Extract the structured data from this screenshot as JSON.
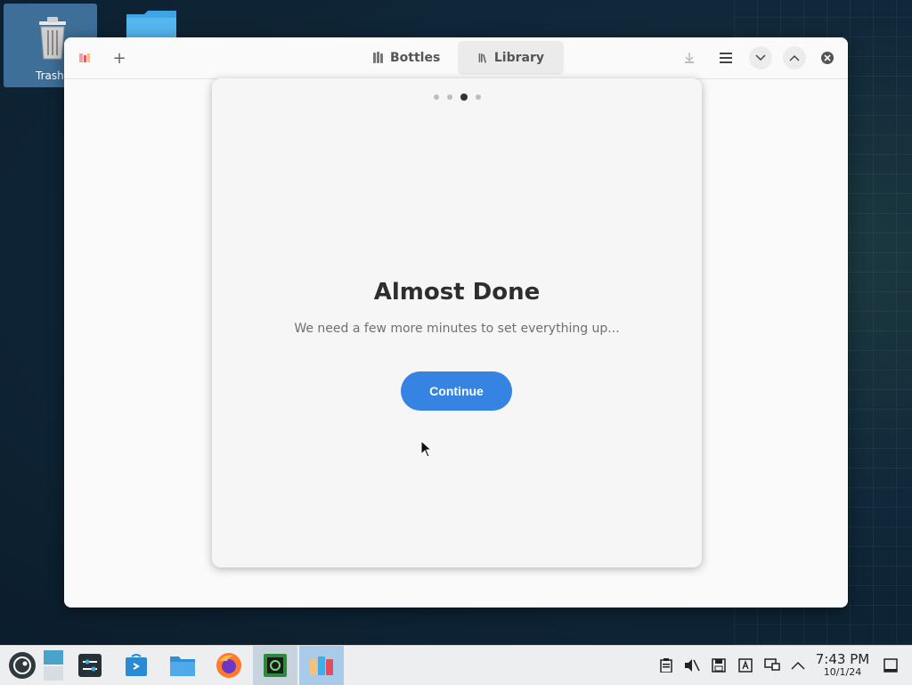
{
  "desktop": {
    "icons": [
      {
        "label": "Trash",
        "icon": "trash-icon"
      },
      {
        "label": "",
        "icon": "folder-icon"
      }
    ]
  },
  "window": {
    "tabs": [
      {
        "label": "Bottles",
        "icon": "bottles-icon",
        "active": false
      },
      {
        "label": "Library",
        "icon": "library-icon",
        "active": true
      }
    ],
    "header_buttons": [
      "app-logo-icon",
      "add-icon",
      "download-icon",
      "menu-icon",
      "minimize-icon",
      "maximize-icon",
      "close-icon"
    ]
  },
  "dialog": {
    "title": "Almost Done",
    "subtitle": "We need a few more minutes to set everything up...",
    "continue_label": "Continue",
    "pages": 4,
    "current_page": 3
  },
  "taskbar": {
    "apps": [
      "opensuse-launcher-icon",
      "pager-icon",
      "system-settings-icon",
      "discover-icon",
      "file-manager-icon",
      "firefox-icon",
      "terminal-icon",
      "bottles-app-icon"
    ],
    "tray": [
      "clipboard-icon",
      "volume-muted-icon",
      "storage-icon",
      "keyboard-layout-icon",
      "network-icon",
      "tray-expand-icon"
    ],
    "time": "7:43 PM",
    "date": "10/1/24",
    "accent_color": "#3584e4"
  }
}
